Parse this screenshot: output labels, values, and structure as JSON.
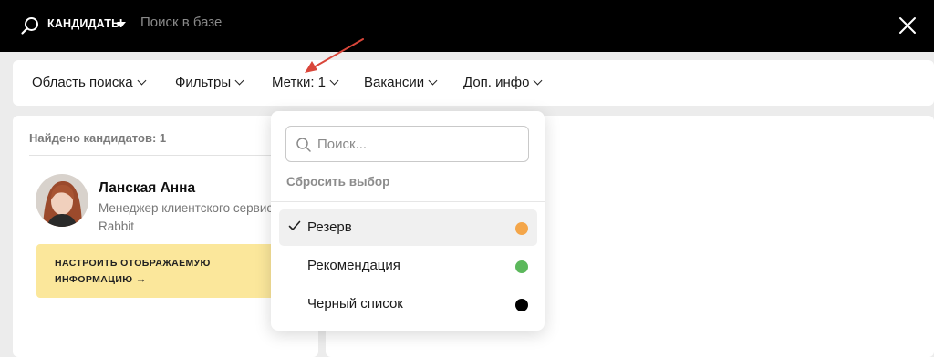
{
  "topbar": {
    "scope_label": "КАНДИДАТЫ",
    "search_placeholder": "Поиск в базе"
  },
  "filters": [
    {
      "label": "Область поиска"
    },
    {
      "label": "Фильтры"
    },
    {
      "label": "Метки: 1"
    },
    {
      "label": "Вакансии"
    },
    {
      "label": "Доп. инфо"
    }
  ],
  "results": {
    "found_label": "Найдено кандидатов: 1"
  },
  "candidate": {
    "name": "Ланская Анна",
    "role": "Менеджер клиентского сервиса",
    "company": "Rabbit"
  },
  "promo": {
    "text": "НАСТРОИТЬ ОТОБРАЖАЕМУЮ ИНФОРМАЦИЮ",
    "arrow": "→"
  },
  "tags_dropdown": {
    "search_placeholder": "Поиск...",
    "reset_label": "Сбросить выбор",
    "items": [
      {
        "label": "Резерв",
        "selected": true,
        "color": "#f4a64a"
      },
      {
        "label": "Рекомендация",
        "selected": false,
        "color": "#5cb85c"
      },
      {
        "label": "Черный список",
        "selected": false,
        "color": "#000000"
      }
    ]
  },
  "colors": {
    "topbar": "#000000",
    "promo": "#fbe79b",
    "annotation_arrow": "#d9463a"
  }
}
